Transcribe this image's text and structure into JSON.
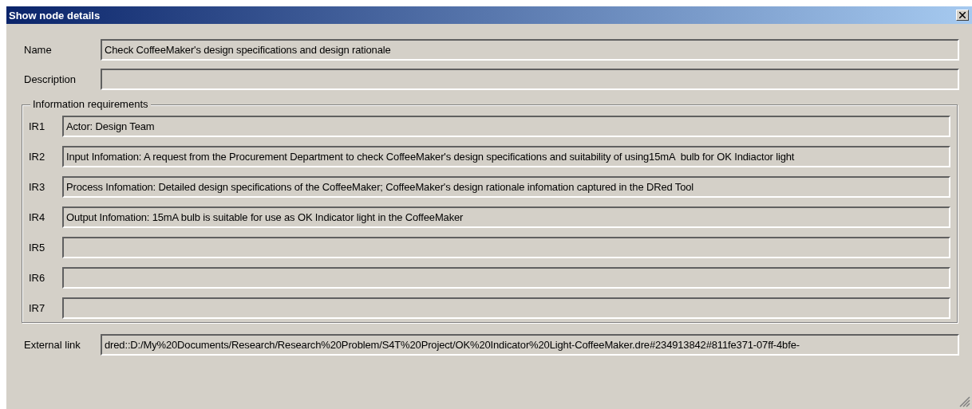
{
  "window": {
    "title": "Show node details"
  },
  "fields": [
    {
      "label": "Name",
      "value": "Check CoffeeMaker's design specifications and design rationale"
    },
    {
      "label": "Description"
    }
  ],
  "information_requirements": {
    "title": "Information requirements",
    "rows": [
      {
        "label": "IR1",
        "value": "Actor: Design Team"
      },
      {
        "label": "IR2",
        "value": "Input Infomation: A request from the Procurement Department to check CoffeeMaker's design specifications and suitability of using15mA  bulb for OK Indiactor light"
      },
      {
        "label": "IR3",
        "value": "Process Infomation: Detailed design specifications of the CoffeeMaker; CoffeeMaker's design rationale infomation captured in the DRed Tool"
      },
      {
        "label": "IR4",
        "value": "Output Infomation: 15mA bulb is suitable for use as OK Indicator light in the CoffeeMaker"
      },
      {
        "label": "IR5"
      },
      {
        "label": "IR6"
      },
      {
        "label": "IR7"
      }
    ]
  },
  "external_link": {
    "label": "External link",
    "value": "dred::D:/My%20Documents/Research/Research%20Problem/S4T%20Project/OK%20Indicator%20Light-CoffeeMaker.dre#234913842#811fe371-07ff-4bfe-"
  }
}
